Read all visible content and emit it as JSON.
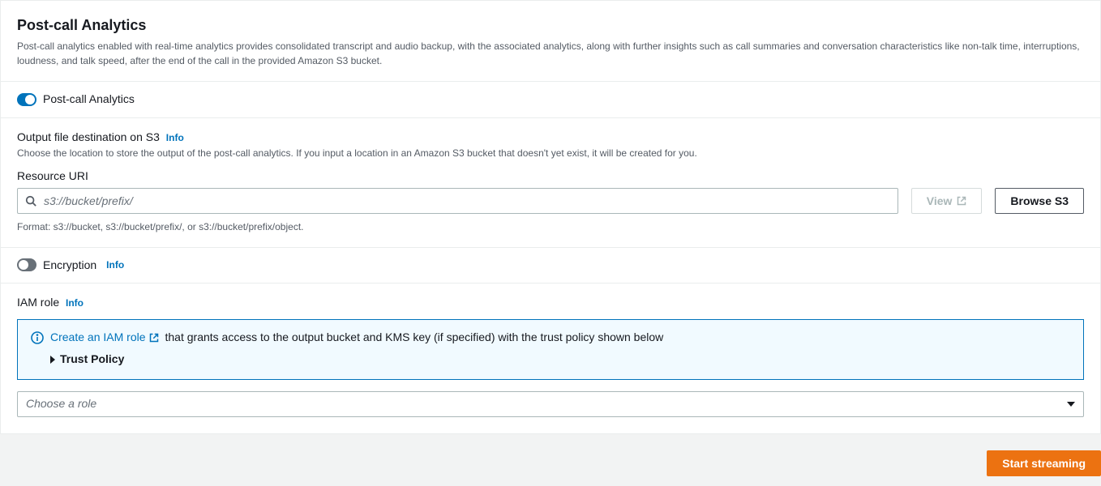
{
  "panel": {
    "title": "Post-call Analytics",
    "description": "Post-call analytics enabled with real-time analytics provides consolidated transcript and audio backup, with the associated analytics, along with further insights such as call summaries and conversation characteristics like non-talk time, interruptions, loudness, and talk speed, after the end of the call in the provided Amazon S3 bucket."
  },
  "toggle_analytics": {
    "label": "Post-call Analytics",
    "on": true
  },
  "output_dest": {
    "label": "Output file destination on S3",
    "info": "Info",
    "hint": "Choose the location to store the output of the post-call analytics. If you input a location in an Amazon S3 bucket that doesn't yet exist, it will be created for you.",
    "resource_label": "Resource URI",
    "placeholder": "s3://bucket/prefix/",
    "view_btn": "View",
    "browse_btn": "Browse S3",
    "format_note": "Format: s3://bucket, s3://bucket/prefix/, or s3://bucket/prefix/object."
  },
  "encryption": {
    "label": "Encryption",
    "info": "Info",
    "on": false
  },
  "iam": {
    "label": "IAM role",
    "info": "Info",
    "create_link": "Create an IAM role",
    "create_suffix": "that grants access to the output bucket and KMS key (if specified) with the trust policy shown below",
    "trust_label": "Trust Policy",
    "select_placeholder": "Choose a role"
  },
  "footer": {
    "start_btn": "Start streaming"
  }
}
